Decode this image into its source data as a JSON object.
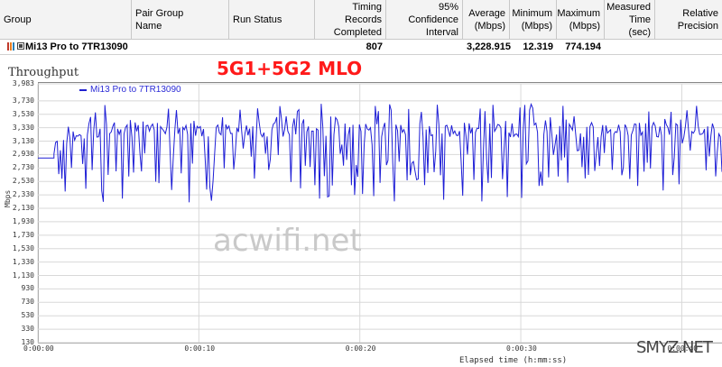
{
  "table": {
    "columns": [
      {
        "label": "Group"
      },
      {
        "label": "Pair Group\nName"
      },
      {
        "label": "Run Status"
      },
      {
        "label": "Timing Records\nCompleted"
      },
      {
        "label": "95% Confidence\nInterval"
      },
      {
        "label": "Average\n(Mbps)"
      },
      {
        "label": "Minimum\n(Mbps)"
      },
      {
        "label": "Maximum\n(Mbps)"
      },
      {
        "label": "Measured\nTime (sec)"
      },
      {
        "label": "Relative\nPrecision"
      }
    ],
    "row": {
      "group": "Mi13 Pro to 7TR13090",
      "records": "807",
      "average": "3,228.915",
      "minimum": "12.319",
      "maximum": "774.194"
    }
  },
  "chart_title": "Throughput",
  "overlay_text": "5G1+5G2 MLO",
  "watermark": "acwifi.net",
  "corner_watermark": "SMYZ.NET",
  "legend_label": "Mi13 Pro to 7TR13090",
  "colors": {
    "series": "#1e1ed6",
    "overlay": "#ff1a1a"
  },
  "chart_data": {
    "type": "line",
    "ylabel": "Mbps",
    "xlabel": "Elapsed time (h:mm:ss)",
    "ylim": [
      130,
      3983
    ],
    "yticks": [
      "3,983",
      "3,730",
      "3,530",
      "3,330",
      "3,130",
      "2,930",
      "2,730",
      "2,530",
      "2,330",
      "2,130",
      "1,930",
      "1,730",
      "1,530",
      "1,330",
      "1,130",
      "930",
      "730",
      "530",
      "330",
      "130"
    ],
    "yvalues": [
      3983,
      3730,
      3530,
      3330,
      3130,
      2930,
      2730,
      2530,
      2330,
      2130,
      1930,
      1730,
      1530,
      1330,
      1130,
      930,
      730,
      530,
      330,
      130
    ],
    "xticks": [
      "0:00:00",
      "0:00:10",
      "0:00:20",
      "0:00:30",
      "0:00:40"
    ],
    "xvalues": [
      0,
      10,
      20,
      30,
      40
    ],
    "xlim": [
      0,
      42.5
    ],
    "grid": true,
    "legend": "top-left",
    "series": [
      {
        "name": "Mi13 Pro to 7TR13090",
        "base": 3300,
        "min_dip": 2200,
        "max_peak": 3720,
        "start": 2880
      }
    ]
  }
}
